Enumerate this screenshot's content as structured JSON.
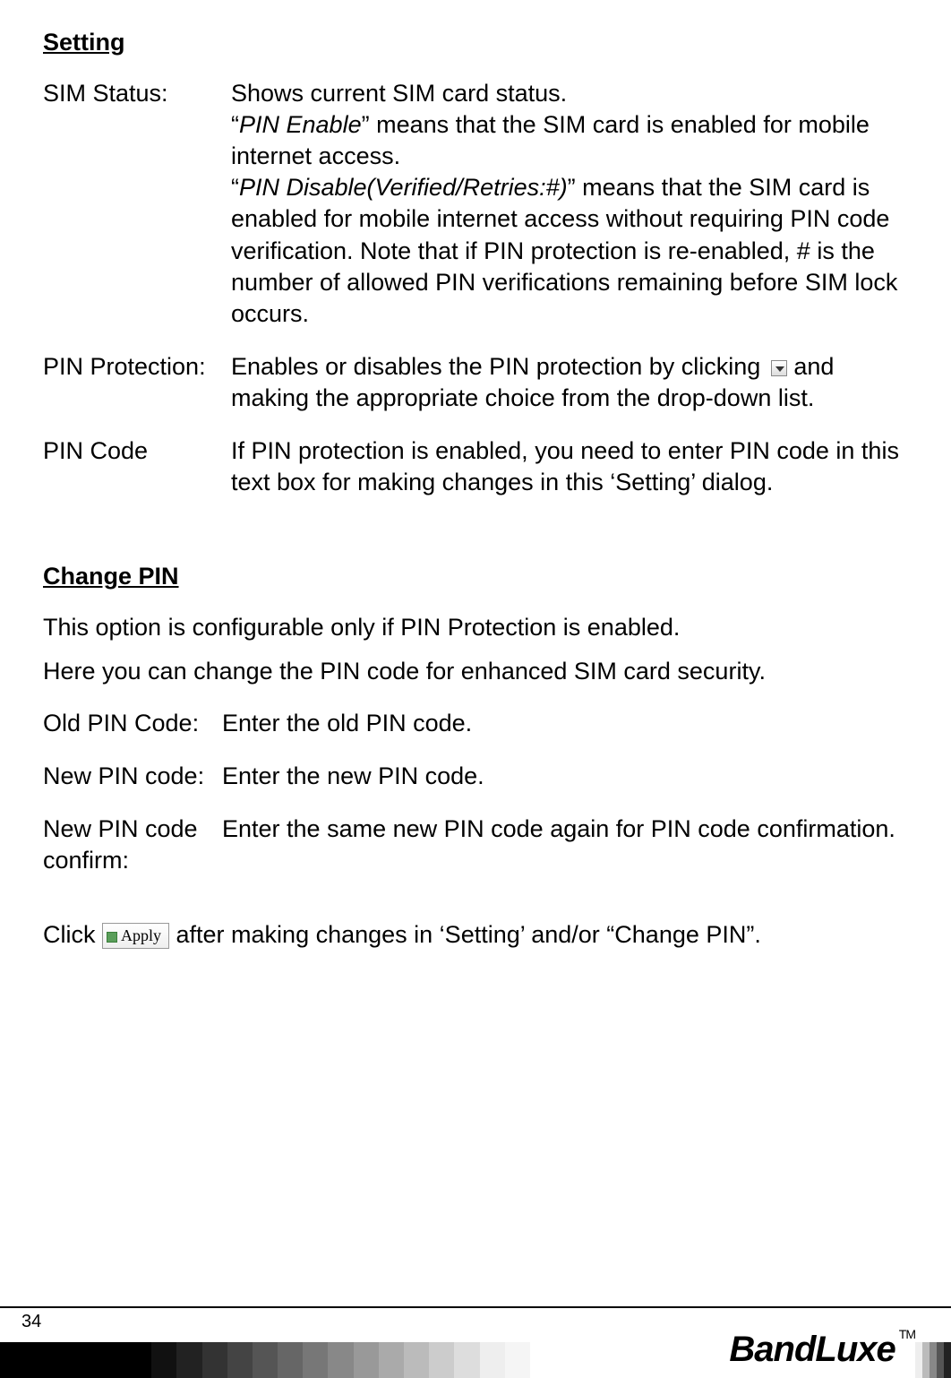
{
  "sections": {
    "setting": {
      "heading": "Setting",
      "rows": [
        {
          "term": "SIM Status:",
          "desc_parts": {
            "p1": "Shows current SIM card status.",
            "p2a": "“",
            "p2italic": "PIN Enable",
            "p2b": "” means that the SIM card is enabled for mobile internet access.",
            "p3a": "“",
            "p3italic": "PIN Disable(Verified/Retries:#)",
            "p3b": "” means that the SIM card is enabled for mobile internet access without requiring PIN code verification. Note that if PIN protection is re-enabled, # is the number of allowed PIN verifications remaining before SIM lock occurs."
          }
        },
        {
          "term": "PIN Protection:",
          "desc_before": "Enables or disables the PIN protection by clicking ",
          "desc_after": " and making the appropriate choice from the drop-down list."
        },
        {
          "term": "PIN Code",
          "desc": "If PIN protection is enabled, you need to enter PIN code in this text box for making changes in this ‘Setting’ dialog."
        }
      ]
    },
    "change_pin": {
      "heading": "Change PIN",
      "intro1": "This option is configurable only if PIN Protection is enabled.",
      "intro2": "Here you can change the PIN code for enhanced SIM card security.",
      "rows": [
        {
          "term": "Old PIN Code:",
          "desc": "Enter the old PIN code."
        },
        {
          "term": "New PIN code:",
          "desc": "Enter the new PIN code."
        },
        {
          "term": "New PIN code confirm:",
          "desc": "Enter the same new PIN code again for PIN code confirmation."
        }
      ]
    },
    "click_line": {
      "before": "Click ",
      "button_label": "Apply",
      "after": " after making changes in ‘Setting’ and/or “Change PIN”."
    }
  },
  "footer": {
    "page_number": "34",
    "logo_text": "BandLuxe",
    "tm": "TM"
  }
}
